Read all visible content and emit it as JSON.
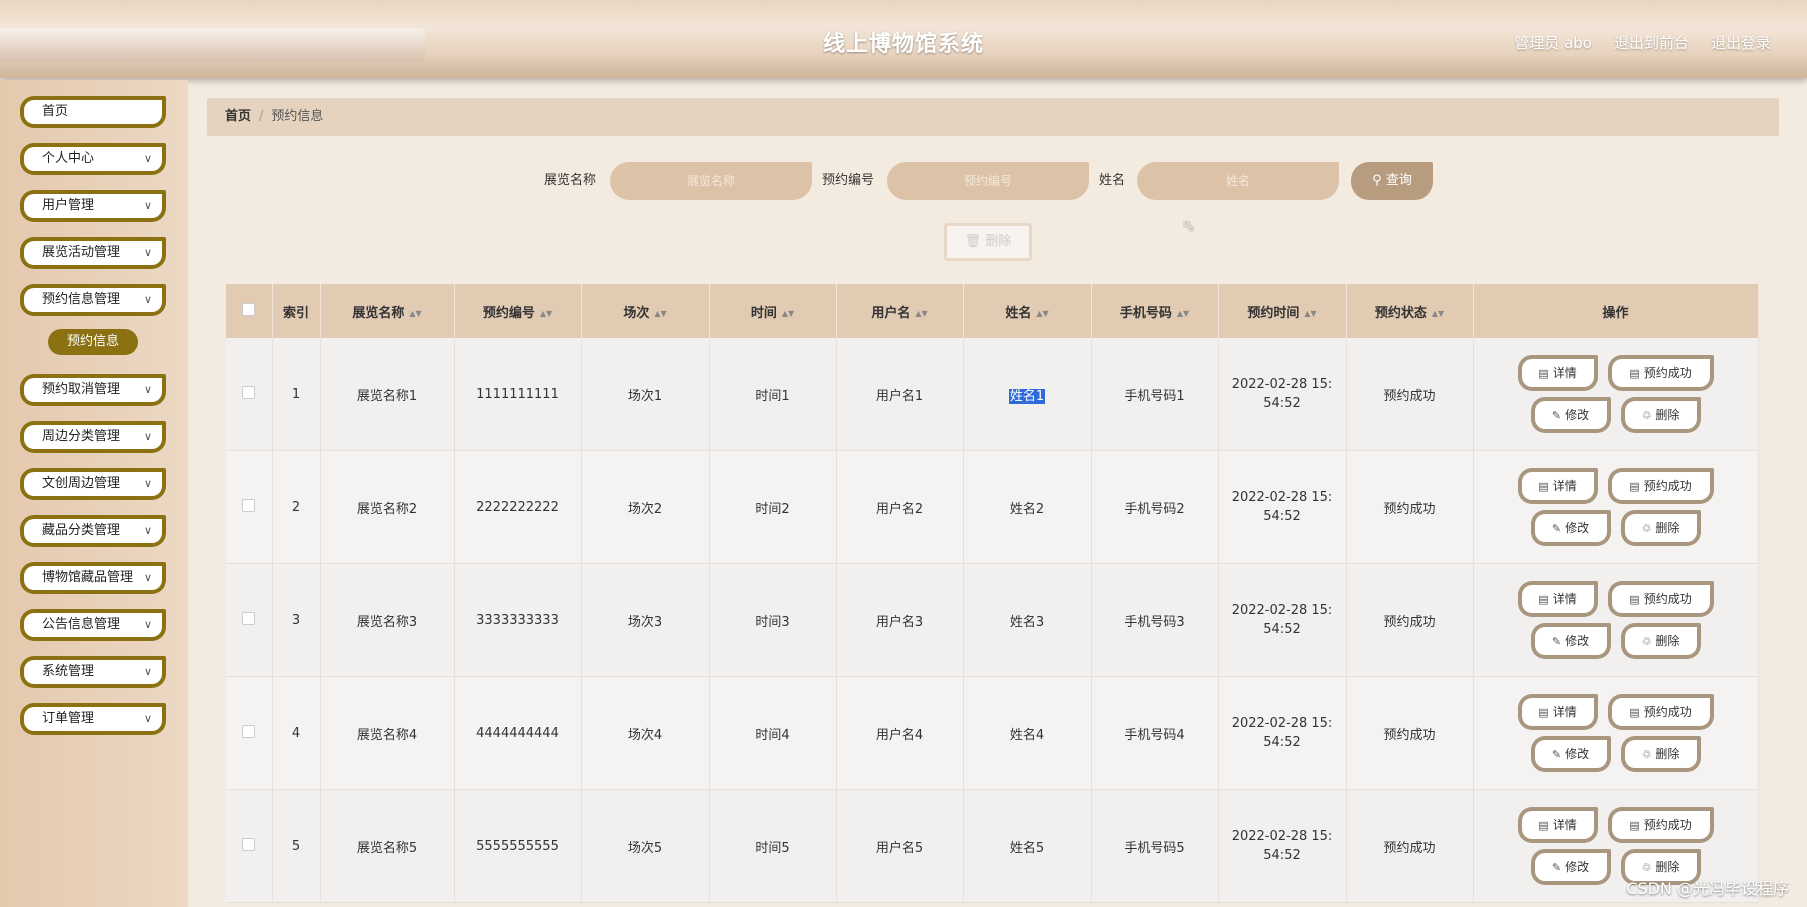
{
  "header": {
    "title": "线上博物馆系统",
    "links": [
      "管理员 abo",
      "退出到前台",
      "退出登录"
    ]
  },
  "sidebar": {
    "items": [
      {
        "label": "首页",
        "has_chevron": false
      },
      {
        "label": "个人中心",
        "has_chevron": true
      },
      {
        "label": "用户管理",
        "has_chevron": true
      },
      {
        "label": "展览活动管理",
        "has_chevron": true
      },
      {
        "label": "预约信息管理",
        "has_chevron": true
      },
      {
        "label": "预约取消管理",
        "has_chevron": true
      },
      {
        "label": "周边分类管理",
        "has_chevron": true
      },
      {
        "label": "文创周边管理",
        "has_chevron": true
      },
      {
        "label": "藏品分类管理",
        "has_chevron": true
      },
      {
        "label": "博物馆藏品管理",
        "has_chevron": true
      },
      {
        "label": "公告信息管理",
        "has_chevron": true
      },
      {
        "label": "系统管理",
        "has_chevron": true
      },
      {
        "label": "订单管理",
        "has_chevron": true
      }
    ],
    "active_sub": "预约信息"
  },
  "breadcrumb": {
    "home": "首页",
    "sep": "/",
    "current": "预约信息"
  },
  "search": {
    "fields": [
      {
        "label": "展览名称",
        "placeholder": "展览名称"
      },
      {
        "label": "预约编号",
        "placeholder": "预约编号"
      },
      {
        "label": "姓名",
        "placeholder": "姓名"
      }
    ],
    "query_label": "查询",
    "delete_label": "删除"
  },
  "table": {
    "columns": [
      "索引",
      "展览名称",
      "预约编号",
      "场次",
      "时间",
      "用户名",
      "姓名",
      "手机号码",
      "预约时间",
      "预约状态",
      "操作"
    ],
    "rows": [
      {
        "index": "1",
        "name": "展览名称1",
        "no": "1111111111",
        "session": "场次1",
        "time": "时间1",
        "user": "用户名1",
        "realname": "姓名1",
        "phone": "手机号码1",
        "booked": "2022-02-28 15:54:52",
        "status": "预约成功"
      },
      {
        "index": "2",
        "name": "展览名称2",
        "no": "2222222222",
        "session": "场次2",
        "time": "时间2",
        "user": "用户名2",
        "realname": "姓名2",
        "phone": "手机号码2",
        "booked": "2022-02-28 15:54:52",
        "status": "预约成功"
      },
      {
        "index": "3",
        "name": "展览名称3",
        "no": "3333333333",
        "session": "场次3",
        "time": "时间3",
        "user": "用户名3",
        "realname": "姓名3",
        "phone": "手机号码3",
        "booked": "2022-02-28 15:54:52",
        "status": "预约成功"
      },
      {
        "index": "4",
        "name": "展览名称4",
        "no": "4444444444",
        "session": "场次4",
        "time": "时间4",
        "user": "用户名4",
        "realname": "姓名4",
        "phone": "手机号码4",
        "booked": "2022-02-28 15:54:52",
        "status": "预约成功"
      },
      {
        "index": "5",
        "name": "展览名称5",
        "no": "5555555555",
        "session": "场次5",
        "time": "时间5",
        "user": "用户名5",
        "realname": "姓名5",
        "phone": "手机号码5",
        "booked": "2022-02-28 15:54:52",
        "status": "预约成功"
      }
    ],
    "actions": [
      "详情",
      "预约成功",
      "修改",
      "删除"
    ]
  },
  "watermark": "CSDN @光冯毕设程序",
  "colors": {
    "accent": "#8b7112",
    "header_bg": "#e2cbb3",
    "button_border": "#a8967f"
  }
}
